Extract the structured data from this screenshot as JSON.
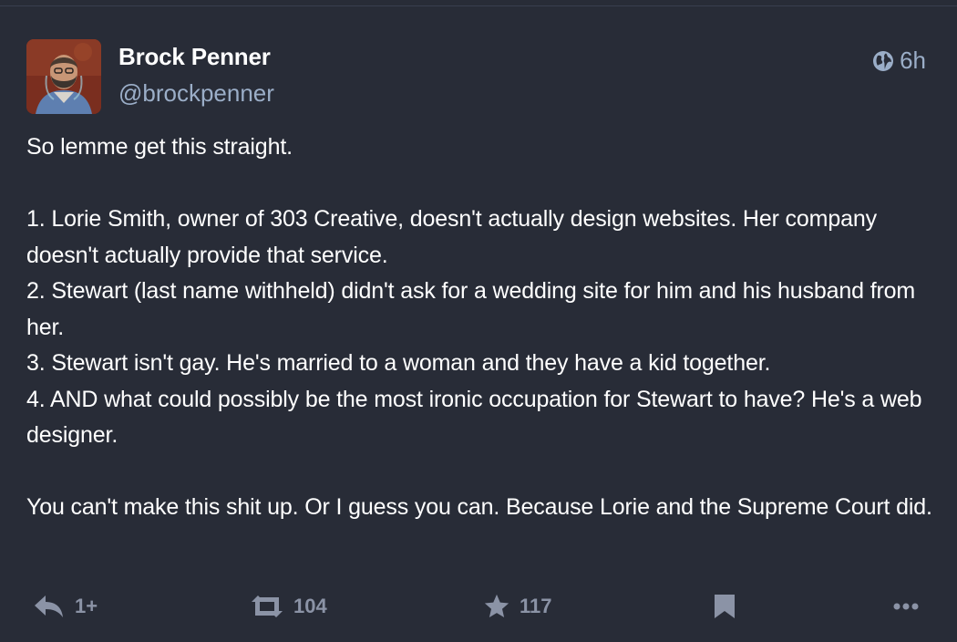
{
  "status": {
    "author": {
      "display_name": "Brock Penner",
      "handle": "@brockpenner"
    },
    "visibility_icon": "globe-icon",
    "relative_time": "6h",
    "content": {
      "paragraphs": [
        [
          "So lemme get this straight."
        ],
        [
          "1. Lorie Smith, owner of 303 Creative, doesn't actually design websites. Her company doesn't actually provide that service.",
          "2. Stewart (last name withheld) didn't ask for a wedding site for him and his husband from her.",
          "3. Stewart isn't gay. He's married to a woman and they have a kid together.",
          "4. AND what could possibly be the most ironic occupation for Stewart to have? He's a web designer."
        ],
        [
          "You can't make this shit up. Or I guess you can. Because Lorie and the Supreme Court did."
        ]
      ]
    },
    "actions": {
      "reply": {
        "icon": "reply-icon",
        "count": "1+"
      },
      "boost": {
        "icon": "boost-icon",
        "count": "104"
      },
      "favourite": {
        "icon": "star-icon",
        "count": "117"
      },
      "bookmark": {
        "icon": "bookmark-icon"
      },
      "more": {
        "icon": "more-icon"
      }
    }
  },
  "colors": {
    "background": "#282c37",
    "text": "#ffffff",
    "secondary_text": "#9baec8",
    "action_icon": "#8b93a6"
  }
}
